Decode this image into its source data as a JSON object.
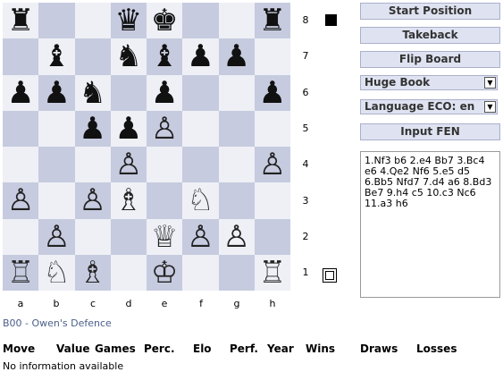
{
  "board": {
    "rows": [
      [
        "♜",
        "",
        "",
        "♛",
        "♚",
        "",
        "",
        "♜"
      ],
      [
        "",
        "♝",
        "",
        "♞",
        "♝",
        "♟",
        "♟",
        ""
      ],
      [
        "♟",
        "♟",
        "♞",
        "",
        "♟",
        "",
        "",
        "♟"
      ],
      [
        "",
        "",
        "♟",
        "♟",
        "♙",
        "",
        "",
        ""
      ],
      [
        "",
        "",
        "",
        "♙",
        "",
        "",
        "",
        "♙"
      ],
      [
        "♙",
        "",
        "♙",
        "♗",
        "",
        "♘",
        "",
        ""
      ],
      [
        "",
        "♙",
        "",
        "",
        "♕",
        "♙",
        "♙",
        ""
      ],
      [
        "♖",
        "♘",
        "♗",
        "",
        "♔",
        "",
        "",
        "♖"
      ]
    ],
    "ranks": [
      "8",
      "7",
      "6",
      "5",
      "4",
      "3",
      "2",
      "1"
    ],
    "files": [
      "a",
      "b",
      "c",
      "d",
      "e",
      "f",
      "g",
      "h"
    ],
    "light_color": "#eef0f6",
    "dark_color": "#c6cbdf"
  },
  "buttons": {
    "start": "Start Position",
    "takeback": "Takeback",
    "flip": "Flip Board",
    "input_fen": "Input FEN"
  },
  "selects": {
    "book": "Huge Book",
    "language": "Language ECO: en"
  },
  "moves_text": "1.Nf3 b6 2.e4 Bb7 3.Bc4\ne6 4.Qe2 Nf6 5.e5 d5\n6.Bb5 Nfd7 7.d4 a6 8.Bd3\nBe7 9.h4 c5 10.c3 Nc6\n11.a3 h6",
  "opening": "B00 - Owen's Defence",
  "table_headers": [
    "Move",
    "Value",
    "Games",
    "Perc.",
    "Elo",
    "Perf.",
    "Year",
    "Wins",
    "Draws",
    "Losses"
  ],
  "no_info": "No information available"
}
